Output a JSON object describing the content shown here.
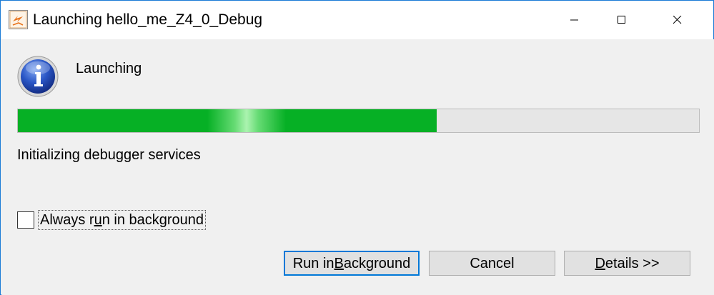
{
  "window": {
    "title": "Launching hello_me_Z4_0_Debug",
    "app_icon": "eclipse-launch-icon",
    "controls": {
      "minimize_icon": "minimize-icon",
      "maximize_icon": "maximize-icon",
      "close_icon": "close-icon"
    }
  },
  "dialog": {
    "icon": "info-icon",
    "heading": "Launching",
    "progress_fraction": 0.615,
    "status": "Initializing debugger services"
  },
  "checkbox": {
    "label_pre": "Always r",
    "label_mnemonic": "u",
    "label_post": "n in background",
    "checked": false
  },
  "buttons": {
    "run_pre": "Run in ",
    "run_mnemonic": "B",
    "run_post": "ackground",
    "cancel": "Cancel",
    "details_mnemonic": "D",
    "details_post": "etails >>"
  },
  "colors": {
    "progress_fill": "#06b025",
    "window_border": "#1a7bd6",
    "focus_border": "#0078d7"
  }
}
